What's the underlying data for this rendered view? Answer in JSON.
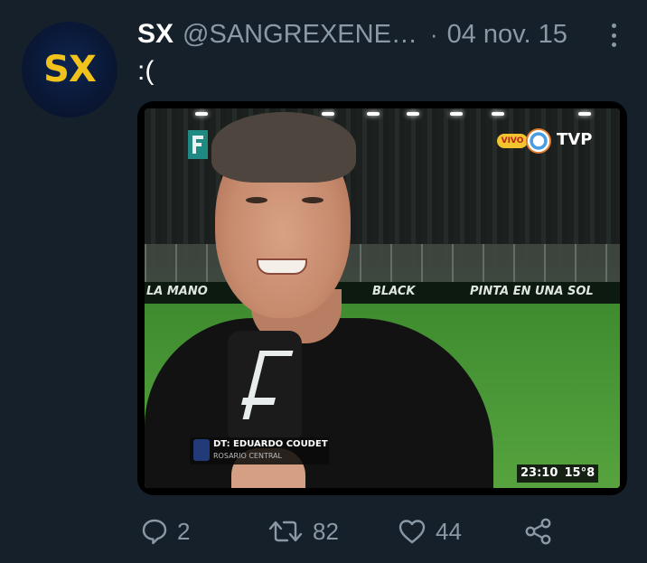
{
  "tweet": {
    "author_name": "SX",
    "author_handle": "@SANGREXENE…",
    "separator": "·",
    "date": "04 nov. 15",
    "text": ":(",
    "avatar_text": "SX"
  },
  "media": {
    "broadcast_logo_live": "VIVO",
    "broadcast_channel": "TVP",
    "ad_texts": [
      "LA MANO",
      "BLACK",
      "PINTA EN UNA SOL"
    ],
    "lower_third_name": "DT: EDUARDO COUDET",
    "lower_third_team": "ROSARIO CENTRAL",
    "clock": "23:10  15°8"
  },
  "actions": {
    "reply_count": "2",
    "retweet_count": "82",
    "like_count": "44"
  },
  "colors": {
    "background": "#15202b",
    "text_primary": "#ffffff",
    "text_secondary": "#8b98a5",
    "avatar_accent": "#f1c21b"
  },
  "icons": [
    "more-vertical-icon",
    "reply-icon",
    "retweet-icon",
    "like-icon",
    "share-icon"
  ]
}
